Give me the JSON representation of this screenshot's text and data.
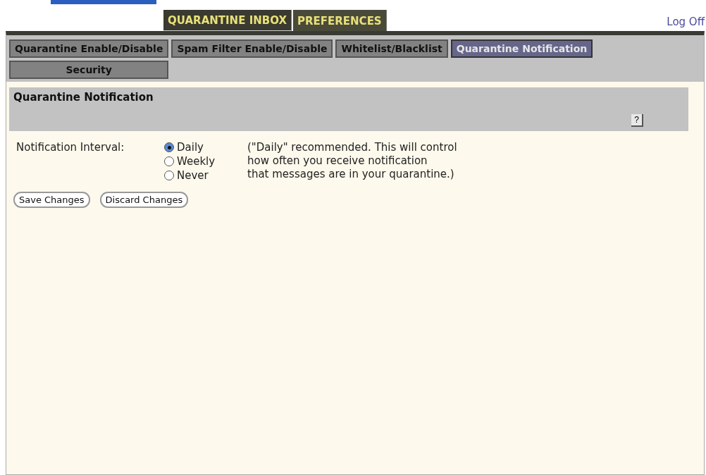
{
  "top_tabs": [
    {
      "label": "QUARANTINE INBOX",
      "selected": false
    },
    {
      "label": "PREFERENCES",
      "selected": true
    }
  ],
  "log_off": "Log Off",
  "sub_tabs": [
    {
      "label": "Quarantine Enable/Disable",
      "selected": false
    },
    {
      "label": "Spam Filter Enable/Disable",
      "selected": false
    },
    {
      "label": "Whitelist/Blacklist",
      "selected": false
    },
    {
      "label": "Quarantine Notification",
      "selected": true
    },
    {
      "label": "Security",
      "selected": false
    }
  ],
  "section": {
    "title": "Quarantine Notification",
    "help": "?"
  },
  "form": {
    "label": "Notification Interval:",
    "options": [
      {
        "label": "Daily",
        "selected": true
      },
      {
        "label": "Weekly",
        "selected": false
      },
      {
        "label": "Never",
        "selected": false
      }
    ],
    "hint": "(\"Daily\" recommended. This will control\nhow often you receive notification\nthat messages are in your quarantine.)"
  },
  "buttons": [
    "Save Changes",
    "Discard Changes"
  ]
}
